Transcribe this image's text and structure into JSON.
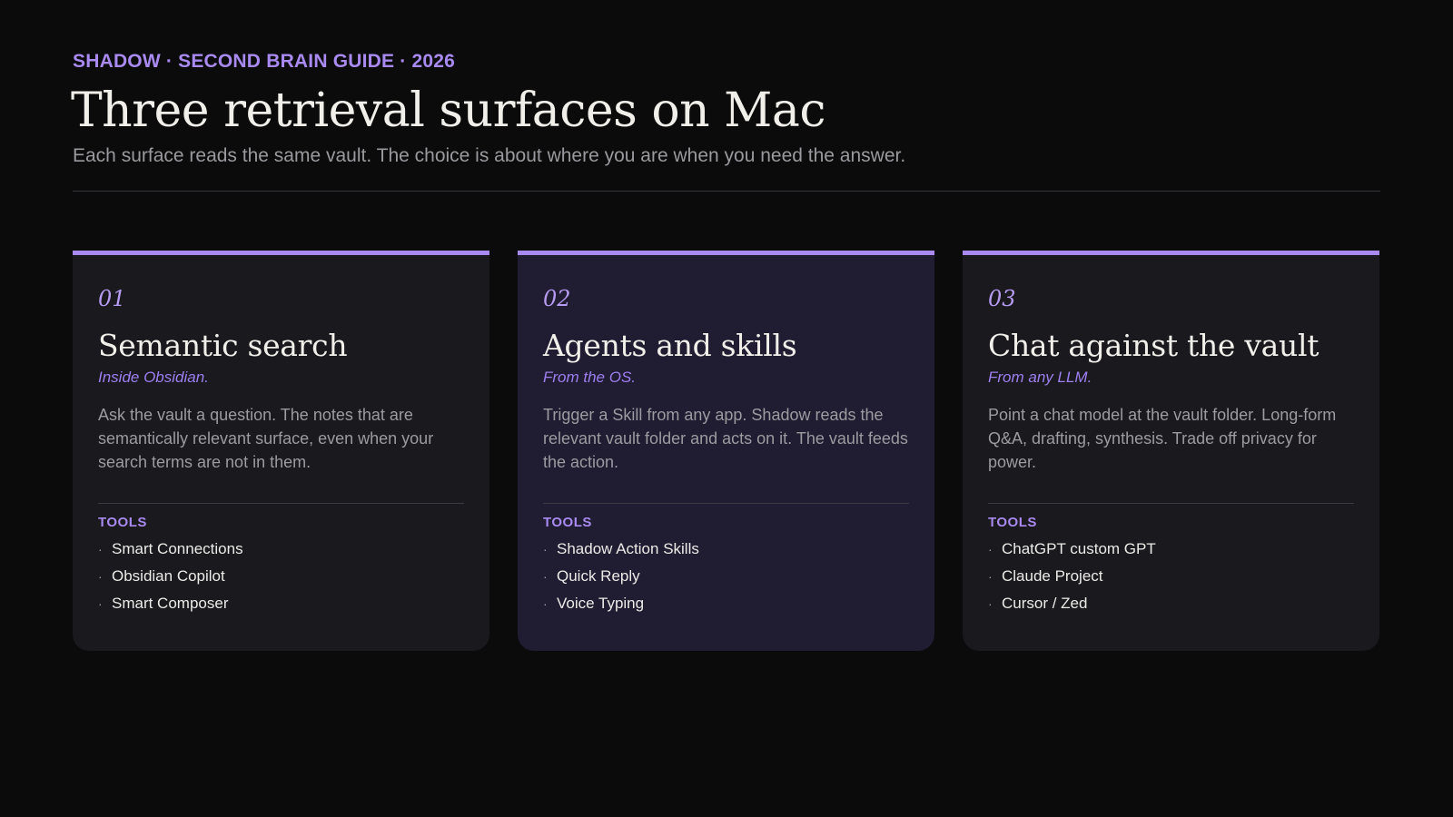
{
  "header": {
    "eyebrow": "SHADOW · SECOND BRAIN GUIDE · 2026",
    "title": "Three retrieval surfaces on Mac",
    "subtitle": "Each surface reads the same vault. The choice is about where you are when you need the answer."
  },
  "colors": {
    "background": "#0b0b0c",
    "accent": "#a98af0",
    "card": "#19191e",
    "card_highlight": "#201c31"
  },
  "tools_label": "TOOLS",
  "bullet_glyph": "·",
  "cards": [
    {
      "number": "01",
      "title": "Semantic search",
      "context": "Inside Obsidian.",
      "description": "Ask the vault a question. The notes that are semantically relevant surface, even when your search terms are not in them.",
      "tools": [
        "Smart Connections",
        "Obsidian Copilot",
        "Smart Composer"
      ]
    },
    {
      "number": "02",
      "title": "Agents and skills",
      "context": "From the OS.",
      "description": "Trigger a Skill from any app. Shadow reads the relevant vault folder and acts on it. The vault feeds the action.",
      "tools": [
        "Shadow Action Skills",
        "Quick Reply",
        "Voice Typing"
      ]
    },
    {
      "number": "03",
      "title": "Chat against the vault",
      "context": "From any LLM.",
      "description": "Point a chat model at the vault folder. Long-form Q&A, drafting, synthesis. Trade off privacy for power.",
      "tools": [
        "ChatGPT custom GPT",
        "Claude Project",
        "Cursor / Zed"
      ]
    }
  ]
}
